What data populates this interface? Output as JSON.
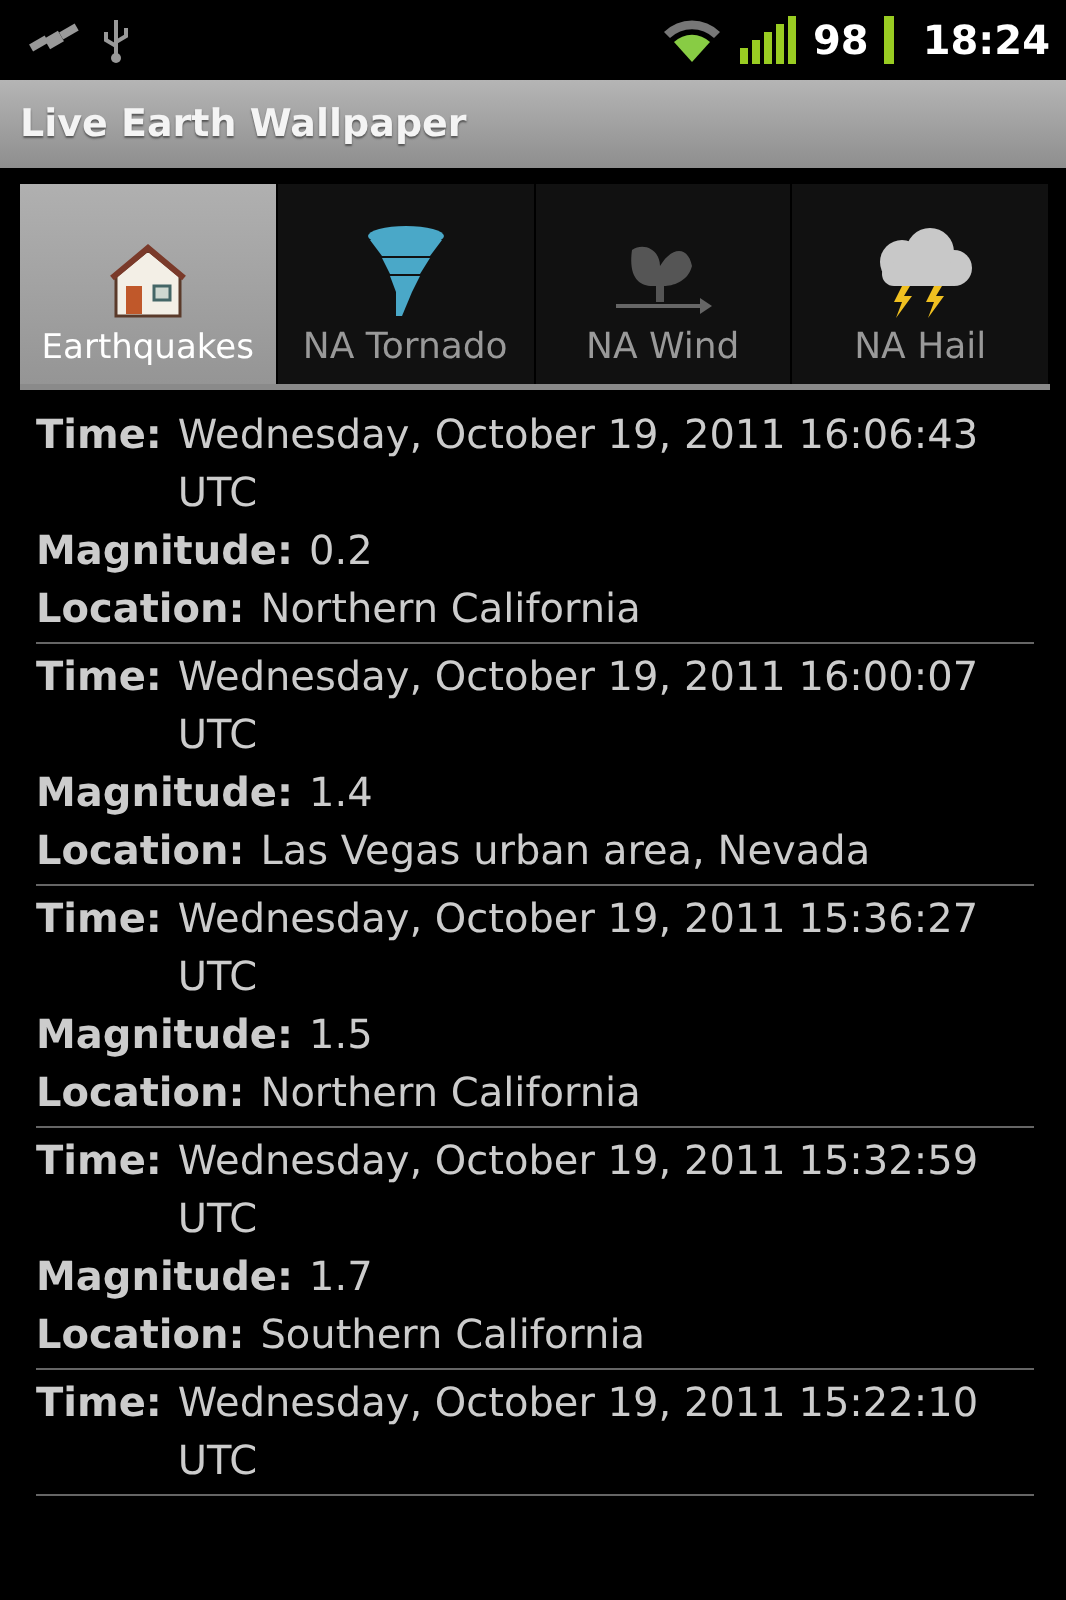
{
  "status_bar": {
    "battery": "98",
    "time": "18:24"
  },
  "title_bar": {
    "title": "Live Earth Wallpaper"
  },
  "tabs": [
    {
      "label": "Earthquakes",
      "kind": "house",
      "selected": true
    },
    {
      "label": "NA Tornado",
      "kind": "tornado",
      "selected": false
    },
    {
      "label": "NA Wind",
      "kind": "wind",
      "selected": false
    },
    {
      "label": "NA Hail",
      "kind": "storm",
      "selected": false
    }
  ],
  "entries": [
    {
      "fields": [
        {
          "label": "Time:",
          "value": "Wednesday, October 19, 2011 16:06:43 UTC"
        },
        {
          "label": "Magnitude:",
          "value": "0.2"
        },
        {
          "label": "Location:",
          "value": "Northern California"
        }
      ]
    },
    {
      "fields": [
        {
          "label": "Time:",
          "value": "Wednesday, October 19, 2011 16:00:07 UTC"
        },
        {
          "label": "Magnitude:",
          "value": "1.4"
        },
        {
          "label": "Location:",
          "value": "Las Vegas urban area, Nevada"
        }
      ]
    },
    {
      "fields": [
        {
          "label": "Time:",
          "value": "Wednesday, October 19, 2011 15:36:27 UTC"
        },
        {
          "label": "Magnitude:",
          "value": "1.5"
        },
        {
          "label": "Location:",
          "value": "Northern California"
        }
      ]
    },
    {
      "fields": [
        {
          "label": "Time:",
          "value": "Wednesday, October 19, 2011 15:32:59 UTC"
        },
        {
          "label": "Magnitude:",
          "value": "1.7"
        },
        {
          "label": "Location:",
          "value": "Southern California"
        }
      ]
    },
    {
      "fields": [
        {
          "label": "Time:",
          "value": "Wednesday, October 19, 2011 15:22:10 UTC"
        }
      ]
    }
  ]
}
